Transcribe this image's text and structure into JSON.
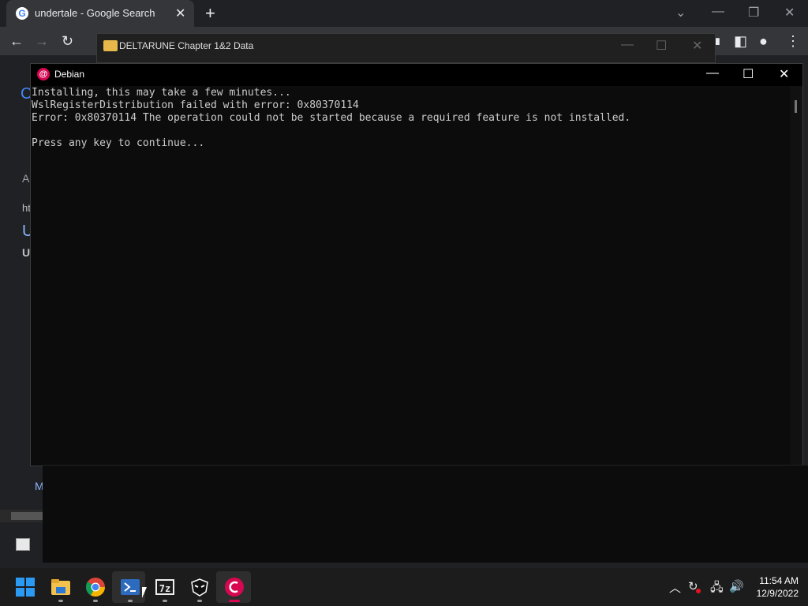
{
  "chrome": {
    "tab_title": "undertale - Google Search",
    "tab_close": "✕",
    "new_tab": "+",
    "partial_left_texts": [
      "A",
      "ht",
      "U",
      "U",
      "M"
    ]
  },
  "explorer": {
    "title": "DELTARUNE Chapter 1&2 Data"
  },
  "console": {
    "title": "Debian",
    "lines": "Installing, this may take a few minutes...\nWslRegisterDistribution failed with error: 0x80370114\nError: 0x80370114 The operation could not be started because a required feature is not installed.\n\nPress any key to continue..."
  },
  "taskbar": {
    "apps": [
      "start-icon",
      "file-explorer-icon",
      "chrome-icon",
      "powershell-icon",
      "7zip-icon",
      "deltarune-icon",
      "debian-icon"
    ],
    "sevenzip_label": "7z",
    "time": "11:54 AM",
    "date": "12/9/2022"
  },
  "colors": {
    "debian": "#d70751",
    "console_bg": "#0c0c0c",
    "chrome_bg": "#202124"
  }
}
